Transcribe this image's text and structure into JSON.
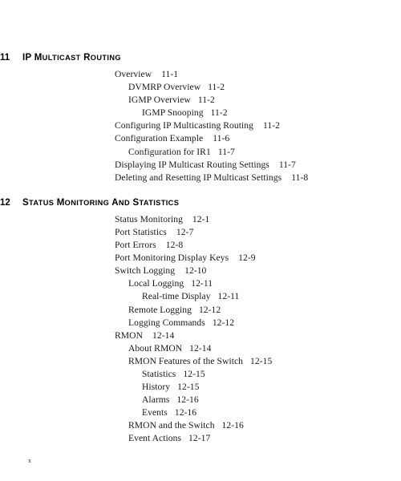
{
  "page": {
    "folio": "x",
    "background_color": "#ffffff",
    "text_color": "#1a1a1a"
  },
  "chapters": [
    {
      "number": "11",
      "title": "IP Multicast Routing",
      "title_display": "IP MULTICAST ROUTING",
      "entries": [
        {
          "level": 1,
          "label": "Overview",
          "page": "11-1"
        },
        {
          "level": 2,
          "label": "DVMRP Overview",
          "page": "11-2"
        },
        {
          "level": 2,
          "label": "IGMP Overview",
          "page": "11-2"
        },
        {
          "level": 3,
          "label": "IGMP Snooping",
          "page": "11-2"
        },
        {
          "level": 1,
          "label": "Configuring IP Multicasting Routing",
          "page": "11-2"
        },
        {
          "level": 1,
          "label": "Configuration Example",
          "page": "11-6"
        },
        {
          "level": 2,
          "label": "Configuration for IR1",
          "page": "11-7"
        },
        {
          "level": 1,
          "label": "Displaying IP Multicast Routing Settings",
          "page": "11-7"
        },
        {
          "level": 1,
          "label": "Deleting and Resetting IP Multicast Settings",
          "page": "11-8"
        }
      ]
    },
    {
      "number": "12",
      "title": "Status Monitoring and Statistics",
      "title_display": "STATUS MONITORING AND STATISTICS",
      "entries": [
        {
          "level": 1,
          "label": "Status Monitoring",
          "page": "12-1"
        },
        {
          "level": 1,
          "label": "Port Statistics",
          "page": "12-7"
        },
        {
          "level": 1,
          "label": "Port Errors",
          "page": "12-8"
        },
        {
          "level": 1,
          "label": "Port Monitoring Display Keys",
          "page": "12-9"
        },
        {
          "level": 1,
          "label": "Switch Logging",
          "page": "12-10"
        },
        {
          "level": 2,
          "label": "Local Logging",
          "page": "12-11"
        },
        {
          "level": 3,
          "label": "Real-time Display",
          "page": "12-11"
        },
        {
          "level": 2,
          "label": "Remote Logging",
          "page": "12-12"
        },
        {
          "level": 2,
          "label": "Logging Commands",
          "page": "12-12"
        },
        {
          "level": 1,
          "label": "RMON",
          "page": "12-14"
        },
        {
          "level": 2,
          "label": "About RMON",
          "page": "12-14"
        },
        {
          "level": 2,
          "label": "RMON Features of the Switch",
          "page": "12-15"
        },
        {
          "level": 3,
          "label": "Statistics",
          "page": "12-15"
        },
        {
          "level": 3,
          "label": "History",
          "page": "12-15"
        },
        {
          "level": 3,
          "label": "Alarms",
          "page": "12-16"
        },
        {
          "level": 3,
          "label": "Events",
          "page": "12-16"
        },
        {
          "level": 2,
          "label": "RMON and the Switch",
          "page": "12-16"
        },
        {
          "level": 2,
          "label": "Event Actions",
          "page": "12-17"
        }
      ]
    }
  ]
}
